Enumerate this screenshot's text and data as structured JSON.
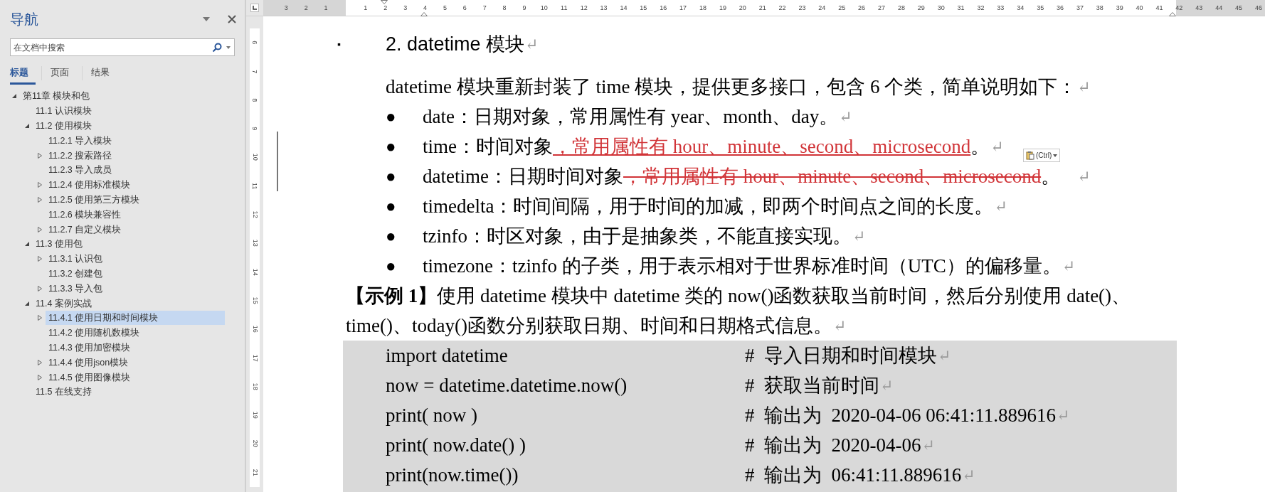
{
  "nav": {
    "title": "导航",
    "search": {
      "placeholder": "在文档中搜索"
    },
    "tabs": [
      {
        "label": "标题",
        "selected": true
      },
      {
        "label": "页面",
        "selected": false
      },
      {
        "label": "结果",
        "selected": false
      }
    ],
    "tree": [
      {
        "label": "第11章 模块和包",
        "expanded": true,
        "selected": false,
        "children": [
          {
            "label": "11.1 认识模块",
            "selected": false
          },
          {
            "label": "11.2 使用模块",
            "expanded": true,
            "selected": false,
            "children": [
              {
                "label": "11.2.1 导入模块",
                "selected": false
              },
              {
                "label": "11.2.2 搜索路径",
                "expanded": false,
                "selected": false
              },
              {
                "label": "11.2.3 导入成员",
                "selected": false
              },
              {
                "label": "11.2.4 使用标准模块",
                "expanded": false,
                "selected": false
              },
              {
                "label": "11.2.5 使用第三方模块",
                "expanded": false,
                "selected": false
              },
              {
                "label": "11.2.6 模块兼容性",
                "selected": false
              },
              {
                "label": "11.2.7 自定义模块",
                "expanded": false,
                "selected": false
              }
            ]
          },
          {
            "label": "11.3 使用包",
            "expanded": true,
            "selected": false,
            "children": [
              {
                "label": "11.3.1 认识包",
                "expanded": false,
                "selected": false
              },
              {
                "label": "11.3.2 创建包",
                "selected": false
              },
              {
                "label": "11.3.3 导入包",
                "expanded": false,
                "selected": false
              }
            ]
          },
          {
            "label": "11.4 案例实战",
            "expanded": true,
            "selected": false,
            "children": [
              {
                "label": "11.4.1 使用日期和时间模块",
                "expanded": false,
                "selected": true
              },
              {
                "label": "11.4.2 使用随机数模块",
                "selected": false
              },
              {
                "label": "11.4.3 使用加密模块",
                "selected": false
              },
              {
                "label": "11.4.4 使用json模块",
                "expanded": false,
                "selected": false
              },
              {
                "label": "11.4.5 使用图像模块",
                "expanded": false,
                "selected": false
              }
            ]
          },
          {
            "label": "11.5 在线支持",
            "selected": false
          }
        ]
      }
    ]
  },
  "ruler": {
    "margin_left_scale": "3 2 1",
    "scale": "1 2 3 4 5 6 7 8 9 10 11 12 13 14 15 16 17 18 19 20 21 22 23 24 25 26 27 28 29 30 31 32 33 34 35 36 37 38 39 40 41",
    "margin_right_scale": "42 43 44 45 46"
  },
  "vertical_ruler": {
    "scale": "6 7 8 9 10 11 12 13 14 15 16 17 18 19 20 21"
  },
  "document": {
    "heading": {
      "marker": "▪",
      "text": "2. datetime 模块",
      "mark": "↵"
    },
    "paragraph": {
      "text": "datetime 模块重新封装了 time 模块，提供更多接口，包含 6 个类，简单说明如下：",
      "mark": "↵"
    },
    "bullets": [
      {
        "bullet": "●",
        "segments": [
          {
            "text": "date：日期对象，常用属性有 year、month、day。",
            "inserted": false,
            "deleted": false
          }
        ],
        "mark": "↵"
      },
      {
        "bullet": "●",
        "segments": [
          {
            "text": "time：时间对象",
            "inserted": false,
            "deleted": false
          },
          {
            "text": "，常用属性有 hour、minute、second、microsecond",
            "inserted": true,
            "deleted": false
          },
          {
            "text": "。",
            "inserted": false,
            "deleted": false
          }
        ],
        "mark": "↵"
      },
      {
        "bullet": "●",
        "segments": [
          {
            "text": "datetime：日期时间对象",
            "inserted": false,
            "deleted": false
          },
          {
            "text": "，常用属性有 hour、minute、second、microsecond",
            "inserted": false,
            "deleted": true
          },
          {
            "text": "。",
            "inserted": false,
            "deleted": false
          }
        ],
        "mark": "↵"
      },
      {
        "bullet": "●",
        "segments": [
          {
            "text": "timedelta：时间间隔，用于时间的加减，即两个时间点之间的长度。",
            "inserted": false,
            "deleted": false
          }
        ],
        "mark": "↵"
      },
      {
        "bullet": "●",
        "segments": [
          {
            "text": "tzinfo：时区对象，由于是抽象类，不能直接实现。",
            "inserted": false,
            "deleted": false
          }
        ],
        "mark": "↵"
      },
      {
        "bullet": "●",
        "segments": [
          {
            "text": "timezone：tzinfo 的子类，用于表示相对于世界标准时间（UTC）的偏移量。",
            "inserted": false,
            "deleted": false
          }
        ],
        "mark": "↵"
      }
    ],
    "example": {
      "lines": [
        "**【示例 1】**使用 datetime 模块中 datetime 类的 now()函数获取当前时间，然后分别使用 date()、",
        "time()、today()函数分别获取日期、时间和日期格式信息。"
      ],
      "mark": "↵"
    },
    "code": [
      {
        "code": "import datetime",
        "comment": "#  导入日期和时间模块",
        "mark": "↵"
      },
      {
        "code": "now = datetime.datetime.now()",
        "comment": "#  获取当前时间",
        "mark": "↵"
      },
      {
        "code": "print( now )",
        "comment": "#  输出为  2020-04-06 06:41:11.889616",
        "mark": "↵"
      },
      {
        "code": "print( now.date() )",
        "comment": "#  输出为  2020-04-06",
        "mark": "↵"
      },
      {
        "code": "print(now.time())",
        "comment": "#  输出为  06:41:11.889616",
        "mark": "↵"
      }
    ]
  },
  "paste_options": {
    "label": "(Ctrl)"
  }
}
